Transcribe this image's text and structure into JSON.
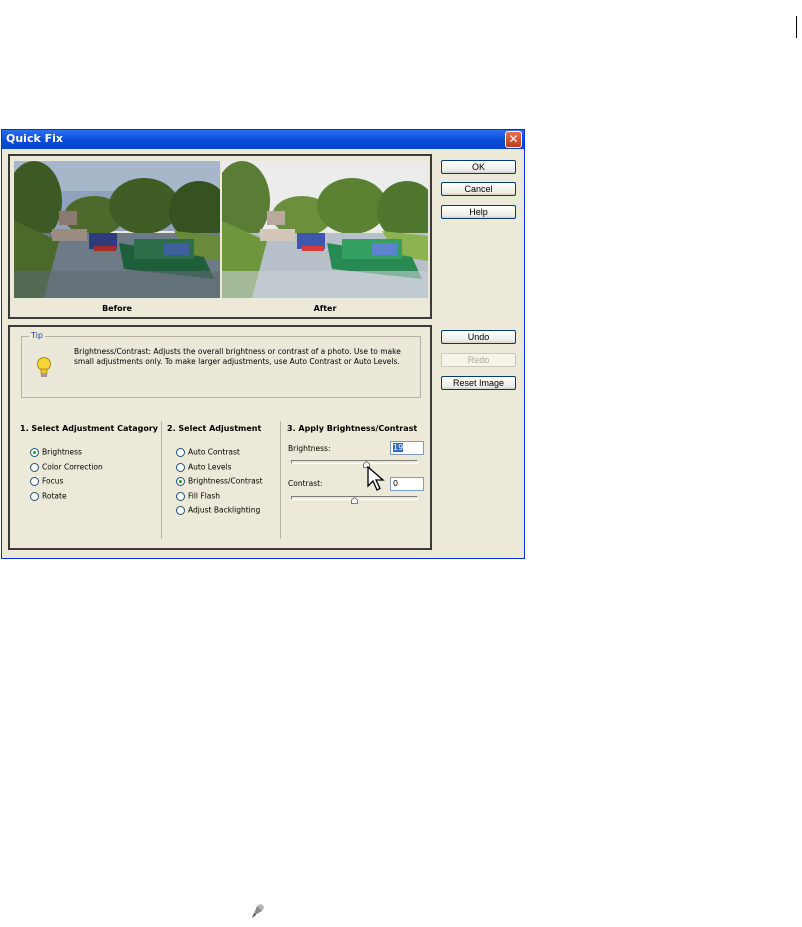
{
  "window": {
    "title": "Quick Fix",
    "close_glyph": "✕"
  },
  "preview": {
    "before_label": "Before",
    "after_label": "After"
  },
  "buttons": {
    "ok": "OK",
    "cancel": "Cancel",
    "help": "Help",
    "undo": "Undo",
    "redo": "Redo",
    "reset_image": "Reset Image"
  },
  "tip": {
    "label": "Tip",
    "text": "Brightness/Contrast: Adjusts the overall brightness or contrast of a photo. Use to make small adjustments only. To make larger adjustments, use  Auto Contrast or Auto Levels.",
    "icon": "lightbulb-icon"
  },
  "category": {
    "heading": "1. Select Adjustment Catagory",
    "options": [
      "Brightness",
      "Color Correction",
      "Focus",
      "Rotate"
    ],
    "selected": "Brightness"
  },
  "adjustment": {
    "heading": "2. Select Adjustment",
    "options": [
      "Auto Contrast",
      "Auto Levels",
      "Brightness/Contrast",
      "Fill Flash",
      "Adjust Backlighting"
    ],
    "selected": "Brightness/Contrast"
  },
  "apply": {
    "heading": "3. Apply Brightness/Contrast",
    "brightness_label": "Brightness:",
    "brightness_value": "19",
    "contrast_label": "Contrast:",
    "contrast_value": "0",
    "slider_range": [
      -100,
      100
    ]
  },
  "colors": {
    "title_bar": "#0a4fd8",
    "dialog_bg": "#ece9d8",
    "selection": "#316ac5"
  },
  "icons": {
    "close": "close-icon",
    "cursor": "arrow-cursor-icon",
    "footer": "pen-tool-icon"
  }
}
